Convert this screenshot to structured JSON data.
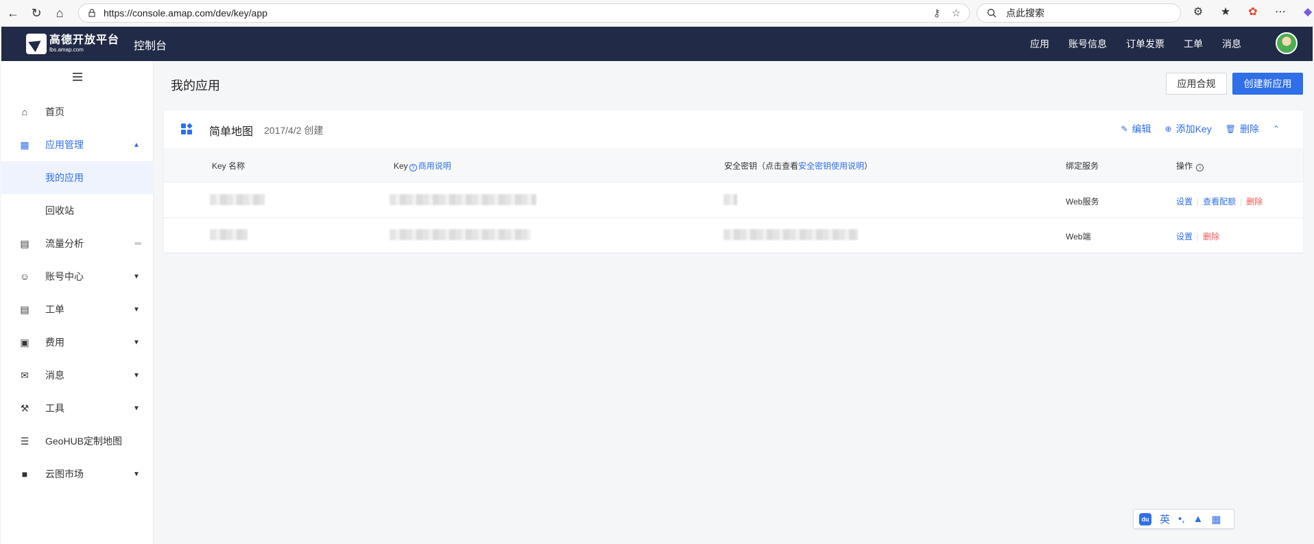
{
  "browser": {
    "url": "https://console.amap.com/dev/key/app",
    "search_placeholder": "点此搜索"
  },
  "header": {
    "logo_name": "高德开放平台",
    "logo_domain": "lbs.amap.com",
    "console_title": "控制台",
    "nav": [
      "应用",
      "账号信息",
      "订单发票",
      "工单",
      "消息"
    ]
  },
  "sidebar": {
    "items": [
      {
        "label": "首页",
        "icon": "home-icon"
      },
      {
        "label": "应用管理",
        "icon": "grid-icon"
      },
      {
        "label": "我的应用"
      },
      {
        "label": "回收站"
      },
      {
        "label": "流量分析",
        "icon": "chart-icon"
      },
      {
        "label": "账号中心",
        "icon": "user-icon"
      },
      {
        "label": "工单",
        "icon": "ticket-icon"
      },
      {
        "label": "费用",
        "icon": "fee-icon"
      },
      {
        "label": "消息",
        "icon": "message-icon"
      },
      {
        "label": "工具",
        "icon": "wrench-icon"
      },
      {
        "label": "GeoHUB定制地图",
        "icon": "layers-icon"
      },
      {
        "label": "云图市场",
        "icon": "store-icon"
      }
    ]
  },
  "main": {
    "title": "我的应用",
    "compliance_button": "应用合规",
    "create_button": "创建新应用",
    "app": {
      "name": "简单地图",
      "created": "2017/4/2 创建",
      "actions": {
        "edit": "编辑",
        "add_key": "添加Key",
        "delete": "删除"
      }
    },
    "table": {
      "headers": {
        "key_name": "Key 名称",
        "key": "Key",
        "key_link": "商用说明",
        "secret_prefix": "安全密钥（点击查看",
        "secret_link": "安全密钥使用说明",
        "secret_suffix": "）",
        "service": "绑定服务",
        "ops": "操作"
      },
      "rows": [
        {
          "service": "Web服务",
          "ops": [
            "设置",
            "查看配额",
            "删除"
          ]
        },
        {
          "service": "Web端",
          "ops": [
            "设置",
            "删除"
          ]
        }
      ]
    }
  },
  "ime": {
    "label": "英"
  },
  "colors": {
    "accent": "#2f6fe7",
    "header_bg": "#212a46",
    "danger": "#f05454"
  }
}
